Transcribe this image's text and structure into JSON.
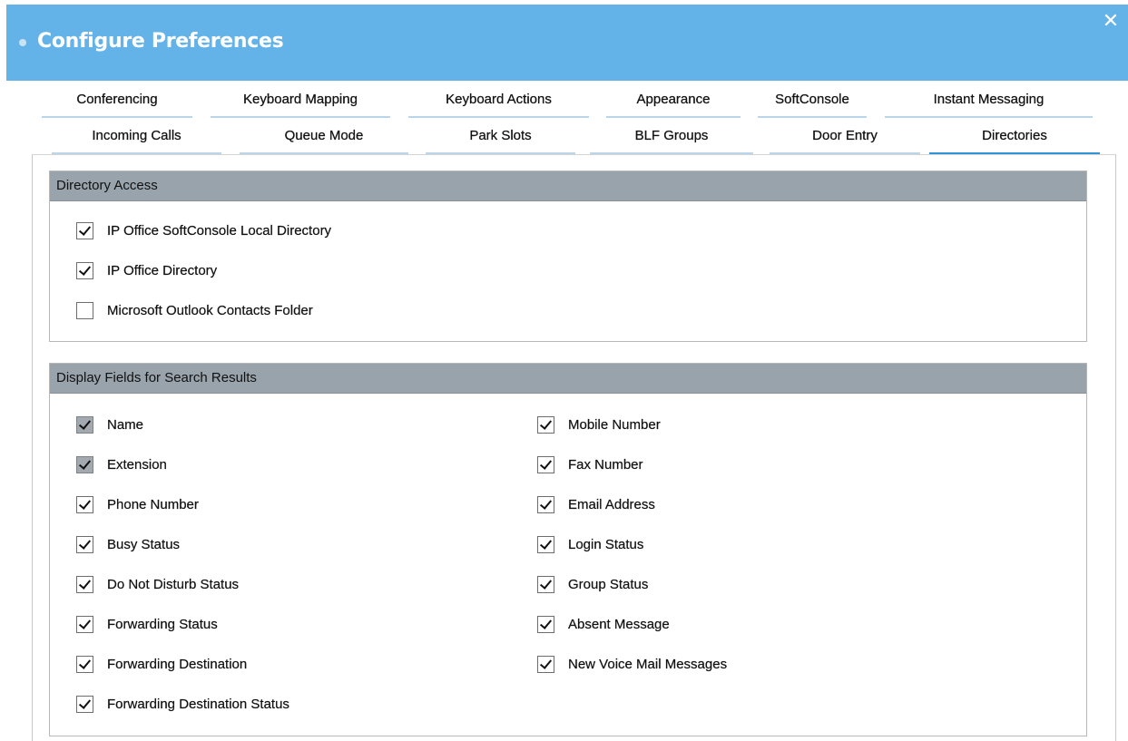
{
  "window": {
    "title": "Configure Preferences",
    "close_glyph": "✕"
  },
  "tabs_row1": [
    {
      "label": "Conferencing"
    },
    {
      "label": "Keyboard Mapping"
    },
    {
      "label": "Keyboard Actions"
    },
    {
      "label": "Appearance"
    },
    {
      "label": "SoftConsole"
    },
    {
      "label": "Instant Messaging"
    }
  ],
  "tabs_row2": [
    {
      "label": "Incoming Calls"
    },
    {
      "label": "Queue Mode"
    },
    {
      "label": "Park Slots"
    },
    {
      "label": "BLF Groups"
    },
    {
      "label": "Door Entry"
    },
    {
      "label": "Directories",
      "active": true
    }
  ],
  "directory_access": {
    "header": "Directory Access",
    "items": [
      {
        "label": "IP Office SoftConsole Local Directory",
        "checked": true
      },
      {
        "label": "IP Office Directory",
        "checked": true
      },
      {
        "label": "Microsoft Outlook Contacts Folder",
        "checked": false
      }
    ]
  },
  "display_fields": {
    "header": "Display Fields for Search Results",
    "left": [
      {
        "label": "Name",
        "checked": true,
        "disabled": true
      },
      {
        "label": "Extension",
        "checked": true,
        "disabled": true
      },
      {
        "label": "Phone Number",
        "checked": true
      },
      {
        "label": "Busy Status",
        "checked": true
      },
      {
        "label": "Do Not Disturb Status",
        "checked": true
      },
      {
        "label": "Forwarding Status",
        "checked": true
      },
      {
        "label": "Forwarding Destination",
        "checked": true
      },
      {
        "label": "Forwarding Destination Status",
        "checked": true
      }
    ],
    "right": [
      {
        "label": "Mobile Number",
        "checked": true
      },
      {
        "label": "Fax Number",
        "checked": true
      },
      {
        "label": "Email Address",
        "checked": true
      },
      {
        "label": "Login Status",
        "checked": true
      },
      {
        "label": "Group Status",
        "checked": true
      },
      {
        "label": "Absent Message",
        "checked": true
      },
      {
        "label": "New Voice Mail Messages",
        "checked": true
      }
    ]
  },
  "colors": {
    "titlebar": "#63b3e8",
    "active_tab_underline": "#2f95d8",
    "group_header": "#99a3ac"
  }
}
